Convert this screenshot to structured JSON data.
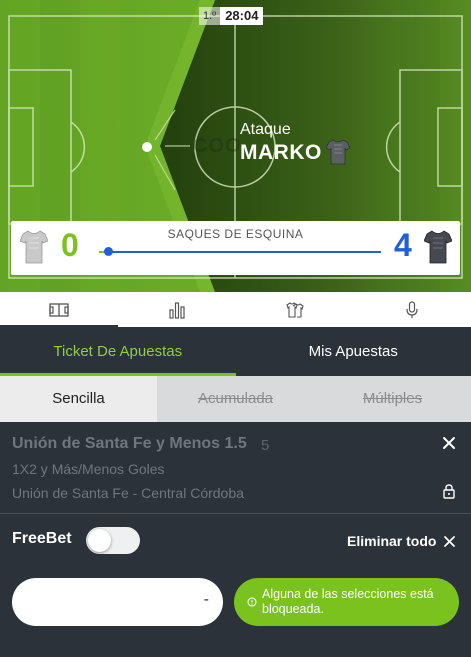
{
  "match": {
    "period": "1.º",
    "clock": "28:04",
    "attack_label": "Ataque",
    "attacking_team": "MARKO",
    "ghost_text": "COO",
    "stat_label": "SAQUES DE ESQUINA",
    "home_value": "0",
    "away_value": "4",
    "home_corners_fraction": 0
  },
  "icon_tabs": [
    {
      "icon": "pitch-icon",
      "active": true
    },
    {
      "icon": "stats-chart-icon",
      "active": false
    },
    {
      "icon": "lineups-icon",
      "active": false
    },
    {
      "icon": "microphone-icon",
      "active": false
    }
  ],
  "bet_tabs": {
    "ticket": "Ticket De Apuestas",
    "my_bets": "Mis Apuestas"
  },
  "bet_types": {
    "single": "Sencilla",
    "accumulator": "Acumulada",
    "multiple": "Múltiples"
  },
  "selection": {
    "title": "Unión de Santa Fe y Menos 1.5",
    "odds": "5",
    "market": "1X2 y Más/Menos Goles",
    "event": "Unión de Santa Fe - Central Córdoba"
  },
  "freebet": {
    "label": "FreeBet",
    "enabled": false,
    "remove_all": "Eliminar todo"
  },
  "stake": {
    "value": "-"
  },
  "warning": {
    "text": "Alguna de las selecciones está bloqueada."
  },
  "colors": {
    "accent_green": "#7ac31f",
    "away_blue": "#1f5fd8",
    "panel_dark": "#2b3239"
  }
}
